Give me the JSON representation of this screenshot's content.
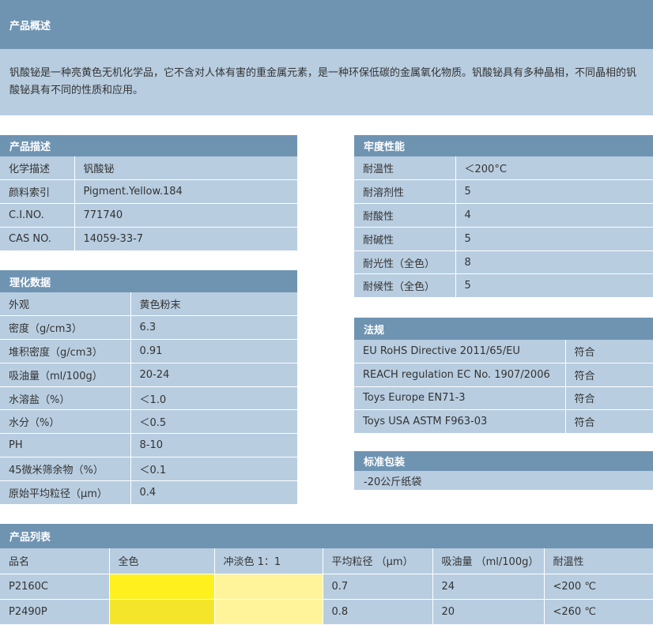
{
  "overview": {
    "title": "产品概述",
    "text": "钒酸铋是一种亮黄色无机化学品，它不含对人体有害的重金属元素，是一种环保低碳的金属氧化物质。钒酸铋具有多种晶相，不同晶相的钒酸铋具有不同的性质和应用。"
  },
  "description": {
    "title": "产品描述",
    "rows": [
      [
        "化学描述",
        "钒酸铋"
      ],
      [
        "颜料索引",
        "Pigment.Yellow.184"
      ],
      [
        "C.I.NO.",
        "771740"
      ],
      [
        "CAS NO.",
        "14059-33-7"
      ]
    ]
  },
  "physchem": {
    "title": "理化数据",
    "rows": [
      [
        "外观",
        "黄色粉末"
      ],
      [
        "密度（g/cm3）",
        "6.3"
      ],
      [
        "堆积密度（g/cm3）",
        "0.91"
      ],
      [
        "吸油量（ml/100g）",
        "20-24"
      ],
      [
        "水溶盐（%）",
        "＜1.0"
      ],
      [
        "水分（%）",
        "＜0.5"
      ],
      [
        "PH",
        "8-10"
      ],
      [
        "45微米筛余物（%）",
        "＜0.1"
      ],
      [
        "原始平均粒径（μm）",
        "0.4"
      ]
    ]
  },
  "fastness": {
    "title": "牢度性能",
    "rows": [
      [
        "耐温性",
        "＜200°C"
      ],
      [
        "耐溶剂性",
        "5"
      ],
      [
        "耐酸性",
        "4"
      ],
      [
        "耐碱性",
        "5"
      ],
      [
        "耐光性（全色）",
        "8"
      ],
      [
        "耐候性（全色）",
        "5"
      ]
    ]
  },
  "regulation": {
    "title": "法规",
    "rows": [
      [
        "EU RoHS Directive 2011/65/EU",
        "符合"
      ],
      [
        "REACH regulation EC No. 1907/2006",
        "符合"
      ],
      [
        "Toys Europe EN71-3",
        "符合"
      ],
      [
        "Toys USA ASTM F963-03",
        "符合"
      ]
    ]
  },
  "packaging": {
    "title": "标准包装",
    "text": "-20公斤纸袋"
  },
  "products": {
    "title": "产品列表",
    "headers": [
      "品名",
      "全色",
      "冲淡色 1：1",
      "平均粒径 （μm）",
      "吸油量 （ml/100g）",
      "耐温性"
    ],
    "rows": [
      {
        "name": "P2160C",
        "mass_color": "#fff01e",
        "tint_color": "#fff49a",
        "size": "0.7",
        "oil": "24",
        "heat": "<200 ℃"
      },
      {
        "name": "P2490P",
        "mass_color": "#f5e52a",
        "tint_color": "#fff49a",
        "size": "0.8",
        "oil": "20",
        "heat": "<260 ℃"
      }
    ]
  }
}
